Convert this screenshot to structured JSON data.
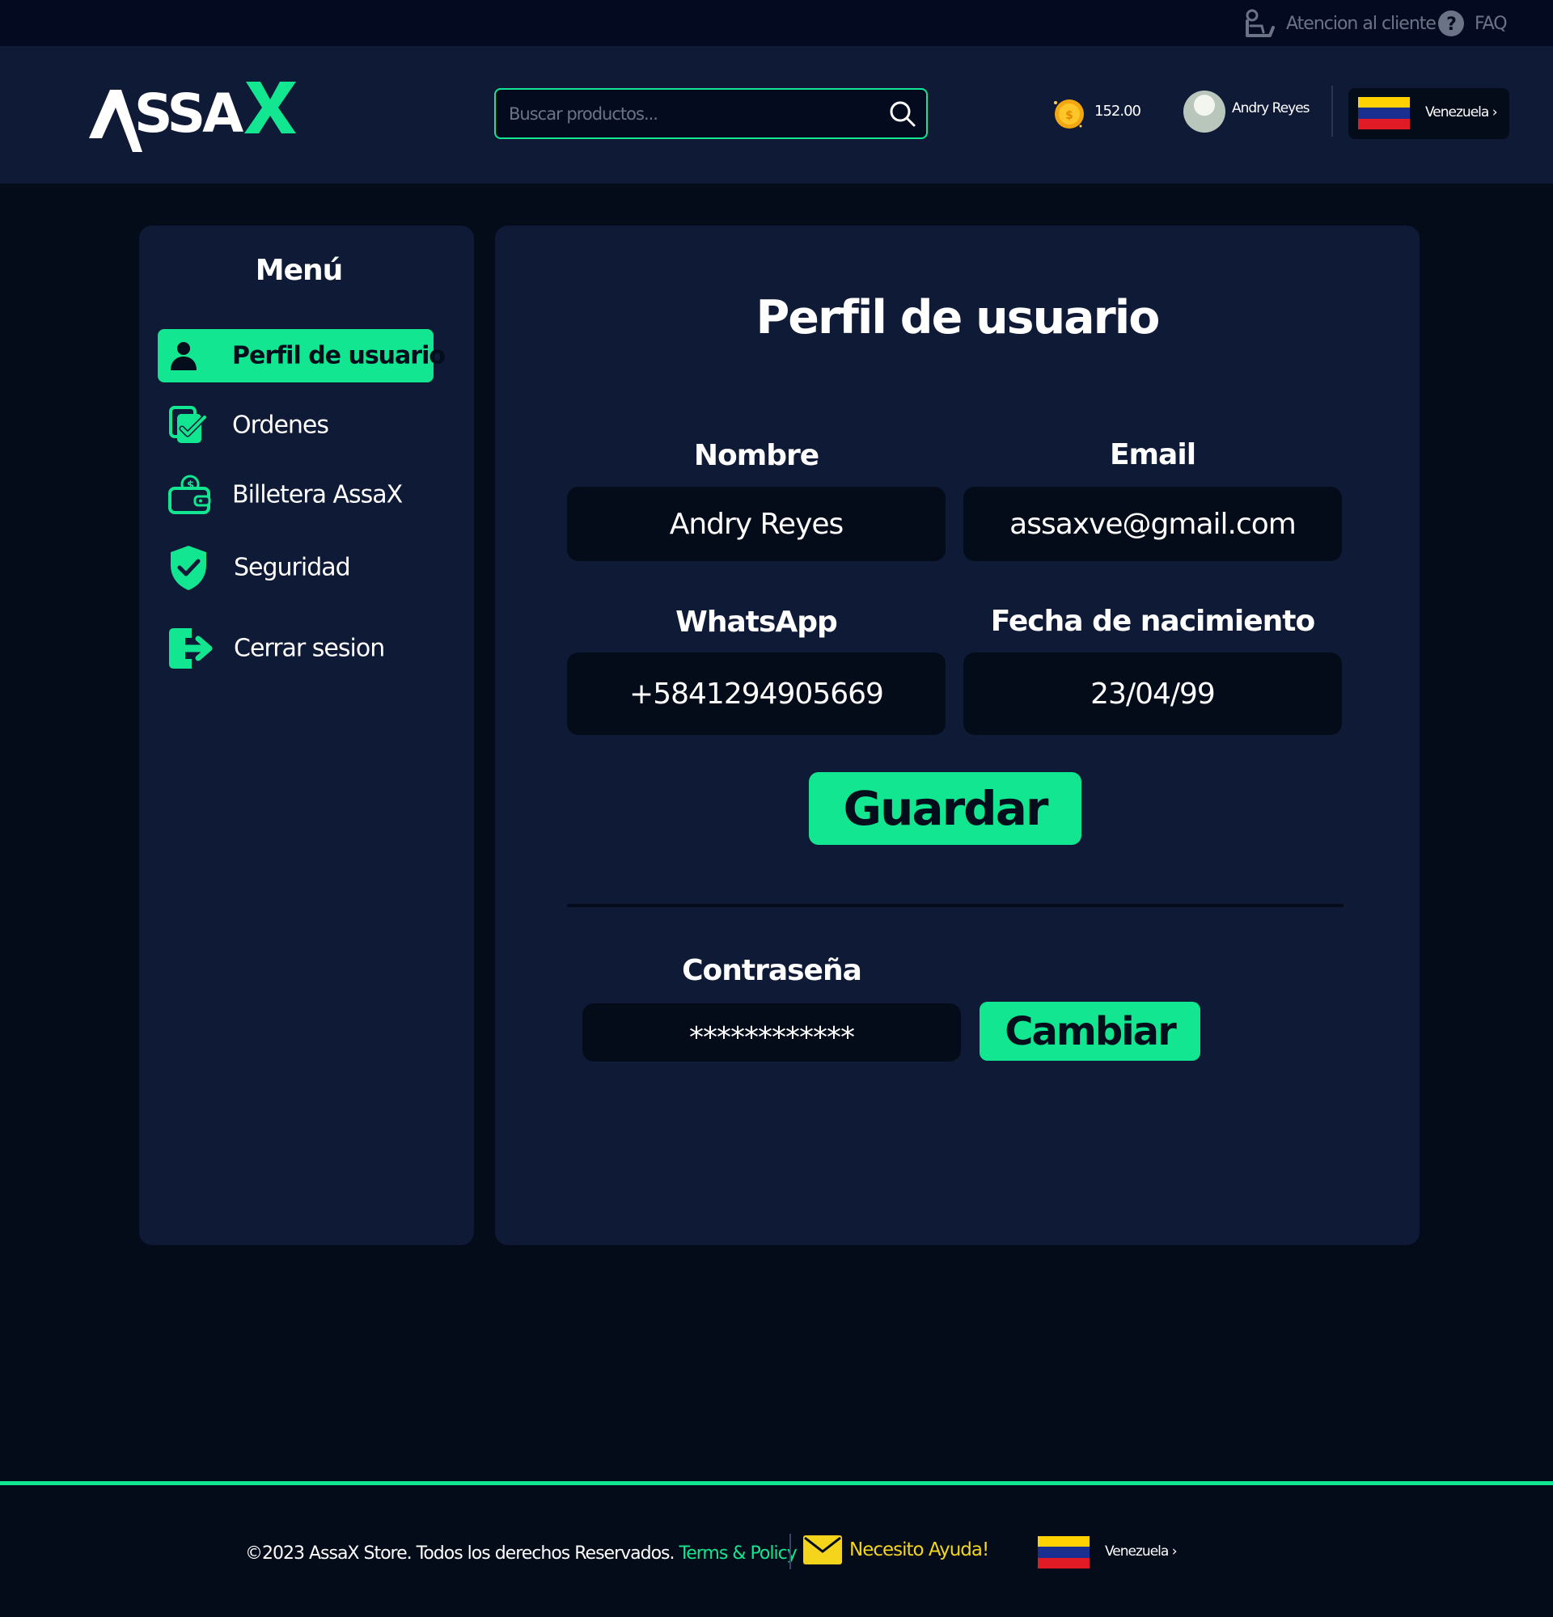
{
  "topbar": {
    "support_label": "Atencion al cliente",
    "faq_label": "FAQ"
  },
  "header": {
    "logo_text": "ASSAX",
    "search_placeholder": "Buscar productos...",
    "balance": "152.00",
    "user_name": "Andry Reyes",
    "country": "Venezuela",
    "country_chevron": "›"
  },
  "sidebar": {
    "title": "Menú",
    "items": [
      {
        "label": "Perfil de usuario",
        "icon": "user-icon",
        "active": true
      },
      {
        "label": "Ordenes",
        "icon": "orders-check-icon",
        "active": false
      },
      {
        "label": "Billetera AssaX",
        "icon": "wallet-icon",
        "active": false
      },
      {
        "label": "Seguridad",
        "icon": "shield-check-icon",
        "active": false
      },
      {
        "label": "Cerrar sesion",
        "icon": "logout-icon",
        "active": false
      }
    ]
  },
  "profile": {
    "title": "Perfil de usuario",
    "fields": {
      "name": {
        "label": "Nombre",
        "value": "Andry Reyes"
      },
      "email": {
        "label": "Email",
        "value": "assaxve@gmail.com"
      },
      "whatsapp": {
        "label": "WhatsApp",
        "value": "+5841294905669"
      },
      "birthdate": {
        "label": "Fecha de nacimiento",
        "value": "23/04/99"
      }
    },
    "save_label": "Guardar",
    "password": {
      "label": "Contraseña",
      "value": "************"
    },
    "change_label": "Cambiar"
  },
  "footer": {
    "copyright": "©2023 AssaX Store. Todos los derechos Reservados.",
    "terms_label": "Terms & Policy",
    "help_label": "Necesito Ayuda!",
    "country": "Venezuela",
    "country_chevron": "›"
  },
  "colors": {
    "accent": "#13e690",
    "header_bg": "#0f1a36",
    "page_bg": "#040b19",
    "help_yellow": "#f4d51c"
  }
}
